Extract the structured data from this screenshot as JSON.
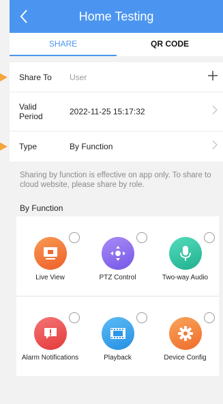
{
  "header": {
    "title": "Home Testing"
  },
  "tabs": [
    {
      "label": "SHARE",
      "active": true
    },
    {
      "label": "QR CODE",
      "active": false
    }
  ],
  "form": {
    "share_to": {
      "label": "Share To",
      "placeholder": "User",
      "action_icon": "plus-icon"
    },
    "valid_period": {
      "label_line1": "Valid",
      "label_line2": "Period",
      "value": "2022-11-25 15:17:32",
      "action_icon": "chevron-right-icon"
    },
    "type": {
      "label": "Type",
      "value": "By Function",
      "action_icon": "chevron-right-icon"
    }
  },
  "note": {
    "line1": "Sharing by function is effective on app only. To share to",
    "line2": "cloud website, please share by role."
  },
  "section_title": "By Function",
  "functions": [
    {
      "label": "Live View",
      "icon": "monitor-icon",
      "color": "#f27a3a",
      "checked": false
    },
    {
      "label": "PTZ Control",
      "icon": "ptz-icon",
      "color": "#8f6cf0",
      "checked": false
    },
    {
      "label": "Two-way Audio",
      "icon": "microphone-icon",
      "color": "#32c7a6",
      "checked": false
    },
    {
      "label": "Alarm Notifications",
      "icon": "alarm-message-icon",
      "color": "#ef4f4f",
      "checked": false
    },
    {
      "label": "Playback",
      "icon": "film-icon",
      "color": "#33a4ef",
      "checked": false
    },
    {
      "label": "Device Config",
      "icon": "gear-icon",
      "color": "#f5843a",
      "checked": false
    }
  ],
  "colors": {
    "accent": "#4b95f0",
    "annotation_arrow": "#f5a53c"
  }
}
